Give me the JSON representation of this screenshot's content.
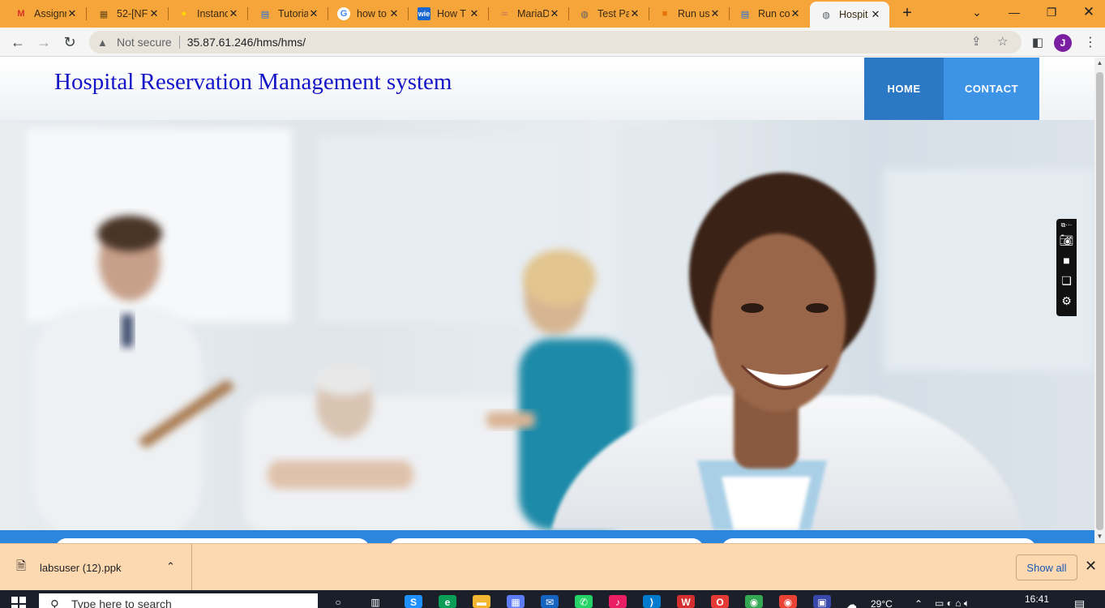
{
  "browser": {
    "tabs": [
      {
        "title": "Assignm",
        "icon": "gmail-icon",
        "active": false
      },
      {
        "title": "52-[NF",
        "icon": "document-icon",
        "active": false
      },
      {
        "title": "Instanc",
        "icon": "bulb-icon",
        "active": false
      },
      {
        "title": "Tutoria",
        "icon": "docs-icon",
        "active": false
      },
      {
        "title": "how to",
        "icon": "google-icon",
        "active": false
      },
      {
        "title": "How T",
        "icon": "wie-icon",
        "active": false
      },
      {
        "title": "MariaD",
        "icon": "mariadb-icon",
        "active": false
      },
      {
        "title": "Test Pa",
        "icon": "globe-icon",
        "active": false
      },
      {
        "title": "Run us",
        "icon": "box-icon",
        "active": false
      },
      {
        "title": "Run co",
        "icon": "docs-icon",
        "active": false
      },
      {
        "title": "Hospit",
        "icon": "globe-icon",
        "active": true
      }
    ],
    "security_label": "Not secure",
    "url": "35.87.61.246/hms/hms/",
    "profile_initial": "J"
  },
  "site": {
    "title": "Hospital Reservation Management system",
    "nav": {
      "home": "HOME",
      "contact": "CONTACT"
    },
    "colors": {
      "title": "#1515c8",
      "nav_home": "#2b78c4",
      "nav_contact": "#3d93e6",
      "band": "#2c86dc"
    }
  },
  "downloads": {
    "filename": "labsuser (12).ppk",
    "show_all": "Show all"
  },
  "taskbar": {
    "search_placeholder": "Type here to search",
    "temperature": "29°C",
    "time": "16:41"
  }
}
